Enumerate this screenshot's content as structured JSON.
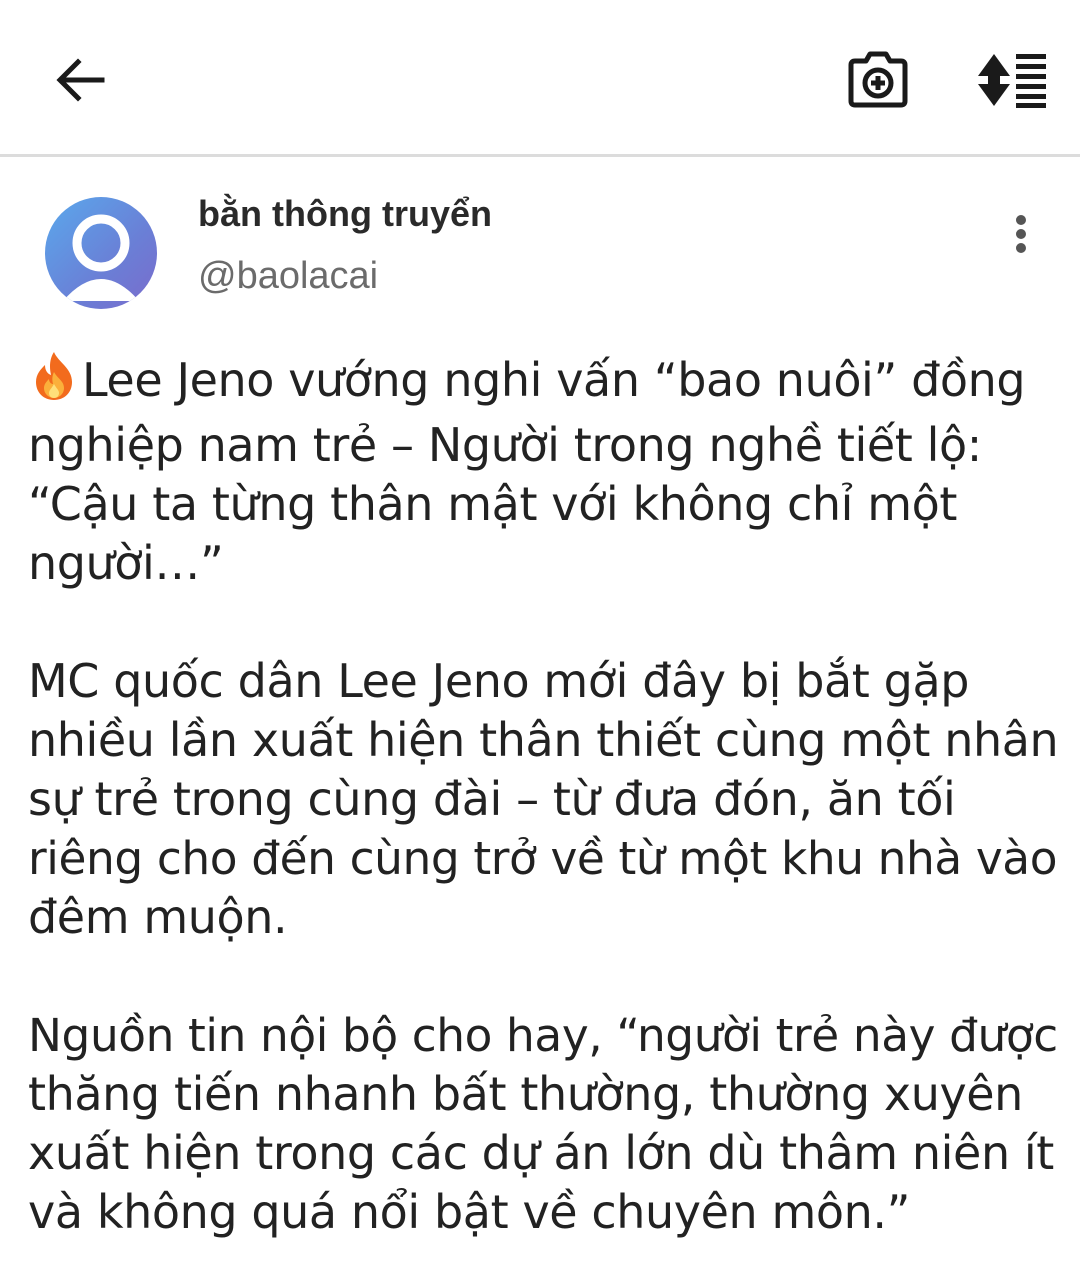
{
  "toolbar": {
    "back_icon": "arrow-left-icon",
    "camera_icon": "camera-add-icon",
    "scroll_icon": "auto-scroll-icon"
  },
  "post": {
    "author": {
      "display_name": "bằn thông truyển",
      "handle": "@baolacai",
      "avatar_icon": "default-user-avatar"
    },
    "more_icon": "more-vertical-icon",
    "emoji_icon": "fire-icon",
    "paragraphs": [
      {
        "lines": [
          "Lee Jeno vướng nghi vấn “bao nuôi” đồng",
          "nghiệp nam trẻ – Người trong nghề tiết lộ:",
          "“Cậu ta từng thân mật với không chỉ một",
          "người…”"
        ]
      },
      {
        "lines": [
          "MC quốc dân Lee Jeno mới đây bị bắt gặp",
          "nhiều lần xuất hiện thân thiết cùng một nhân",
          "sự trẻ trong cùng đài – từ đưa đón, ăn tối",
          "riêng cho đến cùng trở về từ một khu nhà vào",
          "đêm muộn."
        ]
      },
      {
        "lines": [
          "Nguồn tin nội bộ cho hay, “người trẻ này được",
          "thăng tiến nhanh bất thường, thường xuyên",
          "xuất hiện trong các dự án lớn dù thâm niên ít",
          "và không quá nổi bật về chuyên môn.”"
        ]
      }
    ]
  },
  "colors": {
    "avatar_gradient_start": "#5aa9ec",
    "avatar_gradient_end": "#7a6bcc",
    "text": "#222222",
    "handle": "#6b6b6b",
    "divider": "#dcdcdc"
  }
}
